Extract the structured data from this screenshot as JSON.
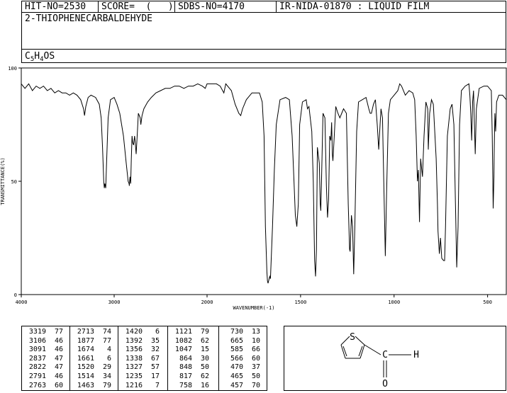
{
  "header": {
    "hit_no": "HIT-NO=2530",
    "score": "SCORE=  (   )",
    "sdbs_no": "SDBS-NO=4170",
    "ir_info": "IR-NIDA-01870 : LIQUID FILM"
  },
  "compound": {
    "name": "2-THIOPHENECARBALDEHYDE",
    "formula_parts": [
      {
        "t": "C",
        "sub": false
      },
      {
        "t": "5",
        "sub": true
      },
      {
        "t": "H",
        "sub": false
      },
      {
        "t": "4",
        "sub": true
      },
      {
        "t": "OS",
        "sub": false
      }
    ]
  },
  "chart_data": {
    "type": "line",
    "xlabel": "WAVENUMBER(-1)",
    "ylabel": "TRANSMITTANCE(%)",
    "xlim": [
      4000,
      400
    ],
    "ylim": [
      0,
      100
    ],
    "x_ticks": [
      4000,
      3000,
      2000,
      1500,
      1000,
      500
    ],
    "x_tick_labels": [
      "4000",
      "3000",
      "2000",
      "1500",
      "1000",
      "500"
    ],
    "y_ticks": [
      0,
      50,
      100
    ],
    "y_tick_labels": [
      "0",
      "50",
      "100"
    ],
    "grid": false,
    "series": [
      {
        "points": [
          [
            4000,
            93
          ],
          [
            3960,
            91
          ],
          [
            3920,
            93
          ],
          [
            3880,
            90
          ],
          [
            3840,
            92
          ],
          [
            3800,
            91
          ],
          [
            3760,
            92
          ],
          [
            3720,
            90
          ],
          [
            3680,
            91
          ],
          [
            3640,
            89
          ],
          [
            3600,
            90
          ],
          [
            3560,
            89
          ],
          [
            3520,
            89
          ],
          [
            3480,
            88
          ],
          [
            3440,
            89
          ],
          [
            3400,
            88
          ],
          [
            3360,
            86
          ],
          [
            3330,
            82
          ],
          [
            3319,
            79
          ],
          [
            3305,
            83
          ],
          [
            3280,
            87
          ],
          [
            3250,
            88
          ],
          [
            3200,
            87
          ],
          [
            3160,
            84
          ],
          [
            3140,
            78
          ],
          [
            3125,
            65
          ],
          [
            3112,
            50
          ],
          [
            3106,
            47
          ],
          [
            3100,
            49
          ],
          [
            3091,
            47
          ],
          [
            3080,
            60
          ],
          [
            3065,
            78
          ],
          [
            3040,
            86
          ],
          [
            3000,
            87
          ],
          [
            2970,
            84
          ],
          [
            2940,
            80
          ],
          [
            2900,
            70
          ],
          [
            2870,
            58
          ],
          [
            2850,
            50
          ],
          [
            2840,
            49
          ],
          [
            2837,
            48
          ],
          [
            2830,
            52
          ],
          [
            2822,
            49
          ],
          [
            2815,
            60
          ],
          [
            2808,
            70
          ],
          [
            2800,
            67
          ],
          [
            2791,
            66
          ],
          [
            2780,
            70
          ],
          [
            2775,
            68
          ],
          [
            2763,
            62
          ],
          [
            2750,
            72
          ],
          [
            2740,
            80
          ],
          [
            2720,
            78
          ],
          [
            2713,
            75
          ],
          [
            2700,
            79
          ],
          [
            2680,
            82
          ],
          [
            2640,
            85
          ],
          [
            2600,
            87
          ],
          [
            2550,
            89
          ],
          [
            2500,
            90
          ],
          [
            2450,
            91
          ],
          [
            2400,
            91
          ],
          [
            2350,
            92
          ],
          [
            2300,
            92
          ],
          [
            2250,
            91
          ],
          [
            2200,
            92
          ],
          [
            2150,
            92
          ],
          [
            2100,
            93
          ],
          [
            2050,
            92
          ],
          [
            2020,
            91
          ],
          [
            2000,
            93
          ],
          [
            1980,
            93
          ],
          [
            1950,
            93
          ],
          [
            1930,
            92
          ],
          [
            1910,
            89
          ],
          [
            1900,
            93
          ],
          [
            1870,
            90
          ],
          [
            1850,
            84
          ],
          [
            1830,
            80
          ],
          [
            1820,
            79
          ],
          [
            1810,
            82
          ],
          [
            1790,
            86
          ],
          [
            1760,
            89
          ],
          [
            1720,
            89
          ],
          [
            1705,
            85
          ],
          [
            1695,
            70
          ],
          [
            1688,
            30
          ],
          [
            1680,
            10
          ],
          [
            1677,
            6
          ],
          [
            1674,
            5
          ],
          [
            1665,
            8
          ],
          [
            1661,
            7
          ],
          [
            1650,
            30
          ],
          [
            1640,
            55
          ],
          [
            1630,
            75
          ],
          [
            1610,
            86
          ],
          [
            1580,
            87
          ],
          [
            1560,
            86
          ],
          [
            1545,
            70
          ],
          [
            1535,
            50
          ],
          [
            1528,
            35
          ],
          [
            1520,
            30
          ],
          [
            1512,
            40
          ],
          [
            1505,
            75
          ],
          [
            1490,
            85
          ],
          [
            1470,
            86
          ],
          [
            1463,
            82
          ],
          [
            1455,
            83
          ],
          [
            1440,
            72
          ],
          [
            1432,
            50
          ],
          [
            1425,
            15
          ],
          [
            1420,
            8
          ],
          [
            1415,
            20
          ],
          [
            1410,
            65
          ],
          [
            1400,
            58
          ],
          [
            1395,
            40
          ],
          [
            1392,
            37
          ],
          [
            1388,
            50
          ],
          [
            1380,
            80
          ],
          [
            1370,
            78
          ],
          [
            1362,
            48
          ],
          [
            1356,
            34
          ],
          [
            1350,
            42
          ],
          [
            1344,
            70
          ],
          [
            1338,
            68
          ],
          [
            1334,
            76
          ],
          [
            1330,
            62
          ],
          [
            1327,
            59
          ],
          [
            1320,
            70
          ],
          [
            1312,
            83
          ],
          [
            1300,
            80
          ],
          [
            1290,
            78
          ],
          [
            1280,
            80
          ],
          [
            1270,
            82
          ],
          [
            1255,
            80
          ],
          [
            1245,
            40
          ],
          [
            1238,
            20
          ],
          [
            1235,
            19
          ],
          [
            1228,
            35
          ],
          [
            1222,
            30
          ],
          [
            1216,
            9
          ],
          [
            1210,
            30
          ],
          [
            1200,
            72
          ],
          [
            1190,
            85
          ],
          [
            1170,
            86
          ],
          [
            1150,
            87
          ],
          [
            1135,
            82
          ],
          [
            1128,
            80
          ],
          [
            1121,
            80
          ],
          [
            1110,
            84
          ],
          [
            1100,
            86
          ],
          [
            1090,
            75
          ],
          [
            1082,
            64
          ],
          [
            1075,
            75
          ],
          [
            1070,
            82
          ],
          [
            1062,
            78
          ],
          [
            1055,
            50
          ],
          [
            1047,
            17
          ],
          [
            1040,
            45
          ],
          [
            1030,
            80
          ],
          [
            1020,
            86
          ],
          [
            1000,
            88
          ],
          [
            980,
            90
          ],
          [
            970,
            93
          ],
          [
            960,
            92
          ],
          [
            940,
            88
          ],
          [
            920,
            90
          ],
          [
            900,
            89
          ],
          [
            890,
            86
          ],
          [
            882,
            70
          ],
          [
            875,
            50
          ],
          [
            870,
            55
          ],
          [
            864,
            32
          ],
          [
            858,
            60
          ],
          [
            852,
            55
          ],
          [
            848,
            52
          ],
          [
            840,
            70
          ],
          [
            830,
            85
          ],
          [
            820,
            82
          ],
          [
            817,
            64
          ],
          [
            810,
            80
          ],
          [
            800,
            86
          ],
          [
            790,
            84
          ],
          [
            775,
            60
          ],
          [
            768,
            40
          ],
          [
            765,
            28
          ],
          [
            758,
            18
          ],
          [
            752,
            25
          ],
          [
            745,
            16
          ],
          [
            735,
            15
          ],
          [
            730,
            15
          ],
          [
            725,
            30
          ],
          [
            715,
            70
          ],
          [
            700,
            82
          ],
          [
            690,
            84
          ],
          [
            680,
            75
          ],
          [
            672,
            40
          ],
          [
            665,
            12
          ],
          [
            658,
            30
          ],
          [
            650,
            75
          ],
          [
            640,
            90
          ],
          [
            620,
            92
          ],
          [
            600,
            93
          ],
          [
            595,
            88
          ],
          [
            590,
            80
          ],
          [
            585,
            68
          ],
          [
            580,
            85
          ],
          [
            575,
            90
          ],
          [
            566,
            62
          ],
          [
            560,
            82
          ],
          [
            545,
            91
          ],
          [
            520,
            92
          ],
          [
            500,
            92
          ],
          [
            480,
            90
          ],
          [
            475,
            70
          ],
          [
            470,
            38
          ],
          [
            466,
            52
          ],
          [
            465,
            62
          ],
          [
            461,
            80
          ],
          [
            457,
            72
          ],
          [
            452,
            85
          ],
          [
            440,
            88
          ],
          [
            420,
            88
          ],
          [
            400,
            86
          ]
        ]
      }
    ]
  },
  "peak_table": {
    "columns": [
      [
        [
          "3319",
          "77"
        ],
        [
          "3106",
          "46"
        ],
        [
          "3091",
          "46"
        ],
        [
          "2837",
          "47"
        ],
        [
          "2822",
          "47"
        ],
        [
          "2791",
          "46"
        ],
        [
          "2763",
          "60"
        ]
      ],
      [
        [
          "2713",
          "74"
        ],
        [
          "1877",
          "77"
        ],
        [
          "1674",
          "4"
        ],
        [
          "1661",
          "6"
        ],
        [
          "1520",
          "29"
        ],
        [
          "1514",
          "34"
        ],
        [
          "1463",
          "79"
        ]
      ],
      [
        [
          "1420",
          "6"
        ],
        [
          "1392",
          "35"
        ],
        [
          "1356",
          "32"
        ],
        [
          "1338",
          "67"
        ],
        [
          "1327",
          "57"
        ],
        [
          "1235",
          "17"
        ],
        [
          "1216",
          "7"
        ]
      ],
      [
        [
          "1121",
          "79"
        ],
        [
          "1082",
          "62"
        ],
        [
          "1047",
          "15"
        ],
        [
          "864",
          "30"
        ],
        [
          "848",
          "50"
        ],
        [
          "817",
          "62"
        ],
        [
          "758",
          "16"
        ]
      ],
      [
        [
          "730",
          "13"
        ],
        [
          "665",
          "10"
        ],
        [
          "585",
          "66"
        ],
        [
          "566",
          "60"
        ],
        [
          "470",
          "37"
        ],
        [
          "465",
          "50"
        ],
        [
          "457",
          "70"
        ]
      ]
    ]
  },
  "structure": {
    "s_label": "S",
    "c_label": "C",
    "h_label": "H",
    "o_label": "O"
  }
}
